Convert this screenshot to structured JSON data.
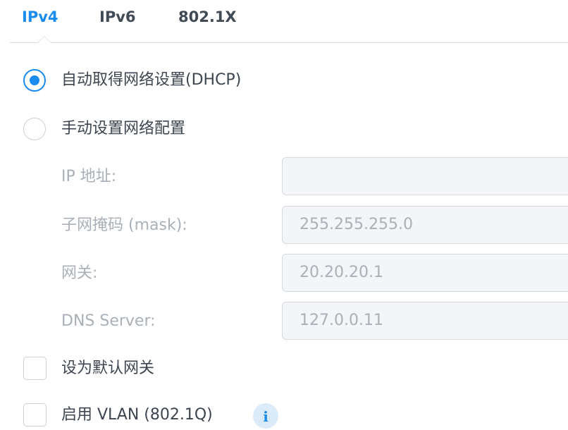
{
  "tabs": [
    {
      "label": "IPv4",
      "active": true
    },
    {
      "label": "IPv6",
      "active": false
    },
    {
      "label": "802.1X",
      "active": false
    }
  ],
  "options": {
    "dhcp_label": "自动取得网络设置(DHCP)",
    "manual_label": "手动设置网络配置",
    "selected": "dhcp"
  },
  "fields": {
    "ip": {
      "label": "IP 地址:",
      "value": ""
    },
    "mask": {
      "label": "子网掩码 (mask):",
      "value": "255.255.255.0"
    },
    "gateway": {
      "label": "网关:",
      "value": "20.20.20.1"
    },
    "dns": {
      "label": "DNS Server:",
      "value": "127.0.0.11"
    }
  },
  "checkboxes": {
    "default_gateway": {
      "label": "设为默认网关",
      "checked": false
    },
    "vlan": {
      "label": "启用 VLAN (802.1Q)",
      "checked": false
    }
  },
  "icons": {
    "info": "i"
  },
  "colors": {
    "accent": "#1a8cf0",
    "text": "#3d4650",
    "muted": "#a9b0b8",
    "field_bg": "#f3f5f8",
    "border": "#d5dae0"
  }
}
